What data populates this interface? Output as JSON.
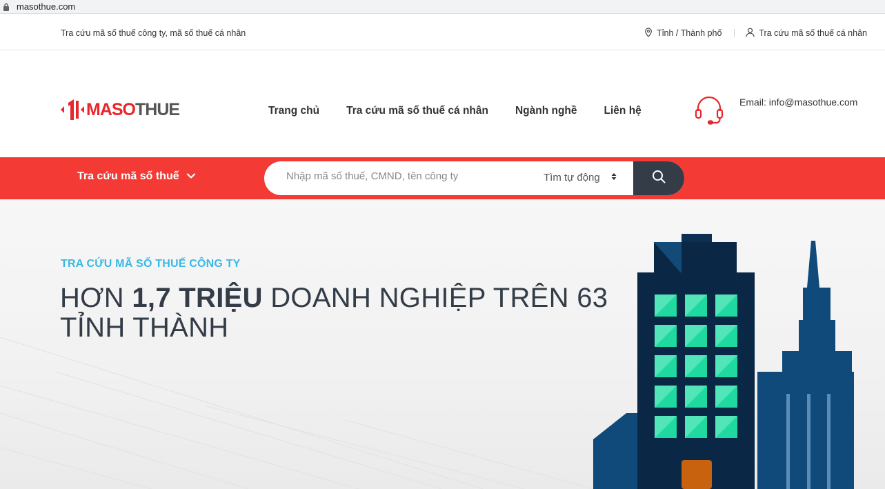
{
  "browser": {
    "url": "masothue.com"
  },
  "topbar": {
    "tagline": "Tra cứu mã số thuế công ty, mã số thuế cá nhân",
    "province_link": "Tỉnh / Thành phố",
    "personal_link": "Tra cứu mã số thuế cá nhân"
  },
  "header": {
    "logo": {
      "part1": "MASO",
      "part2": "THUE"
    },
    "nav": [
      {
        "label": "Trang chủ"
      },
      {
        "label": "Tra cứu mã số thuế cá nhân"
      },
      {
        "label": "Ngành nghề"
      },
      {
        "label": "Liên hệ"
      }
    ],
    "email": "Email: info@masothue.com"
  },
  "searchbar": {
    "dropdown_label": "Tra cứu mã số thuế",
    "placeholder": "Nhập mã số thuế, CMND, tên công ty",
    "mode": "Tìm tự động"
  },
  "hero": {
    "kicker": "TRA CỨU MÃ SỐ THUẾ CÔNG TY",
    "headline_prefix": "HƠN ",
    "headline_bold": "1,7 TRIỆU",
    "headline_suffix": " DOANH NGHIỆP TRÊN 63 TỈNH THÀNH"
  },
  "colors": {
    "brand_red": "#f33a35",
    "dark": "#333c47",
    "accent_blue": "#39b7e6",
    "building_navy": "#0b2a4a",
    "window_green": "#1fd9a0"
  },
  "icons": [
    "lock-icon",
    "map-pin-icon",
    "user-icon",
    "headset-icon",
    "chevron-down-icon",
    "sort-icon",
    "search-icon"
  ]
}
